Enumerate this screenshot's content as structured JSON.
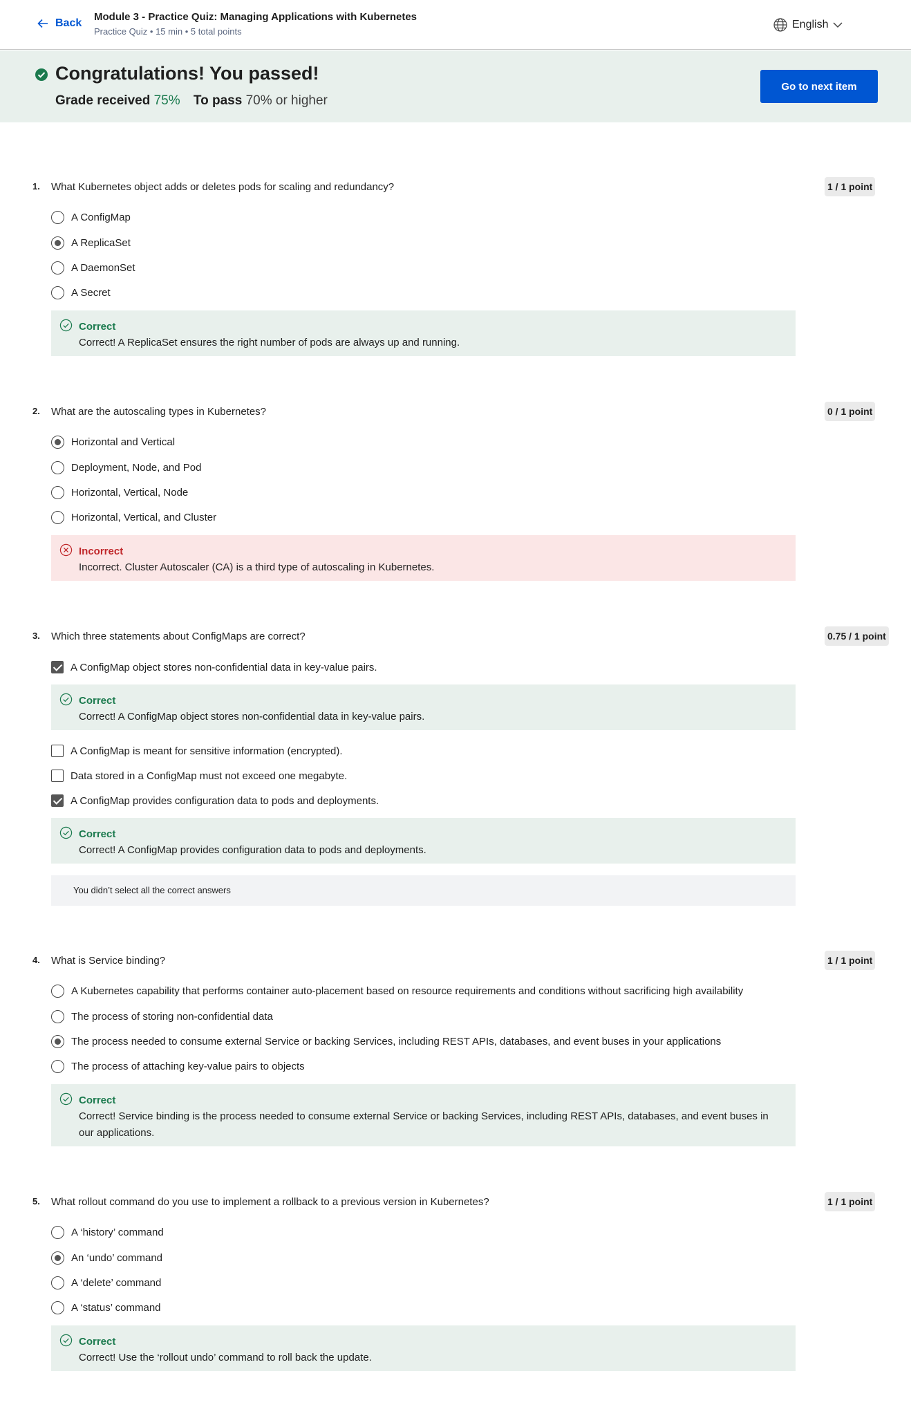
{
  "header": {
    "back_label": "Back",
    "module_title": "Module 3 - Practice Quiz: Managing Applications with Kubernetes",
    "module_subtitle": "Practice Quiz • 15 min • 5 total points",
    "language": "English"
  },
  "banner": {
    "title": "Congratulations! You passed!",
    "grade_label": "Grade received",
    "grade_value": "75%",
    "pass_label": "To pass",
    "pass_value": "70% or higher",
    "next_button": "Go to next item"
  },
  "colors": {
    "accent": "#0056d2",
    "correct": "#1b7a4e",
    "incorrect": "#c0282b",
    "success_bg": "#e8f0ec",
    "error_bg": "#fbe6e6"
  },
  "questions": [
    {
      "num": "1.",
      "text": "What Kubernetes object adds or deletes pods for scaling and redundancy?",
      "points": "1 / 1 point",
      "options": [
        "A ConfigMap",
        "A ReplicaSet",
        "A DaemonSet",
        "A Secret"
      ],
      "selected": [
        1
      ],
      "feedback": [
        {
          "title": "Correct",
          "text": "Correct! A ReplicaSet ensures the right number of pods are always up and running."
        }
      ]
    },
    {
      "num": "2.",
      "text": "What are the autoscaling types in Kubernetes?",
      "points": "0 / 1 point",
      "options": [
        "Horizontal and Vertical",
        "Deployment, Node, and Pod",
        "Horizontal, Vertical, Node",
        "Horizontal, Vertical, and Cluster"
      ],
      "selected": [
        0
      ],
      "feedback": [
        {
          "title": "Incorrect",
          "text": "Incorrect. Cluster Autoscaler (CA) is a third type of autoscaling in Kubernetes."
        }
      ]
    },
    {
      "num": "3.",
      "text": "Which three statements about ConfigMaps are correct?",
      "points": "0.75 / 1 point",
      "options": [
        "A ConfigMap object stores non-confidential data in key-value pairs.",
        "A ConfigMap is meant for sensitive information (encrypted).",
        "Data stored in a ConfigMap must not exceed one megabyte.",
        "A ConfigMap provides configuration data to pods and deployments."
      ],
      "selected": [
        0,
        3
      ],
      "feedback": [
        {
          "title": "Correct",
          "text": "Correct! A ConfigMap object stores non-confidential data in key-value pairs."
        },
        {
          "title": "Correct",
          "text": "Correct! A ConfigMap provides configuration data to pods and deployments."
        }
      ],
      "note": "You didn’t select all the correct answers"
    },
    {
      "num": "4.",
      "text": "What is Service binding?",
      "points": "1 / 1 point",
      "options": [
        "A Kubernetes capability that performs container auto-placement based on resource requirements and conditions without sacrificing high availability",
        "The process of storing non-confidential data",
        "The process needed to consume external Service or backing Services, including REST APIs, databases, and event buses in your applications",
        "The process of attaching key-value pairs to objects"
      ],
      "selected": [
        2
      ],
      "feedback": [
        {
          "title": "Correct",
          "text": "Correct! Service binding is the process needed to consume external Service or backing Services, including REST APIs, databases, and event buses in our applications."
        }
      ]
    },
    {
      "num": "5.",
      "text": "What rollout command do you use to implement a rollback to a previous version in Kubernetes?",
      "points": "1 / 1 point",
      "options": [
        "A ‘history’ command",
        "An ‘undo’ command",
        "A ‘delete’ command",
        "A ‘status’ command"
      ],
      "selected": [
        1
      ],
      "feedback": [
        {
          "title": "Correct",
          "text": "Correct! Use the ‘rollout undo’ command to roll back the update."
        }
      ]
    }
  ]
}
